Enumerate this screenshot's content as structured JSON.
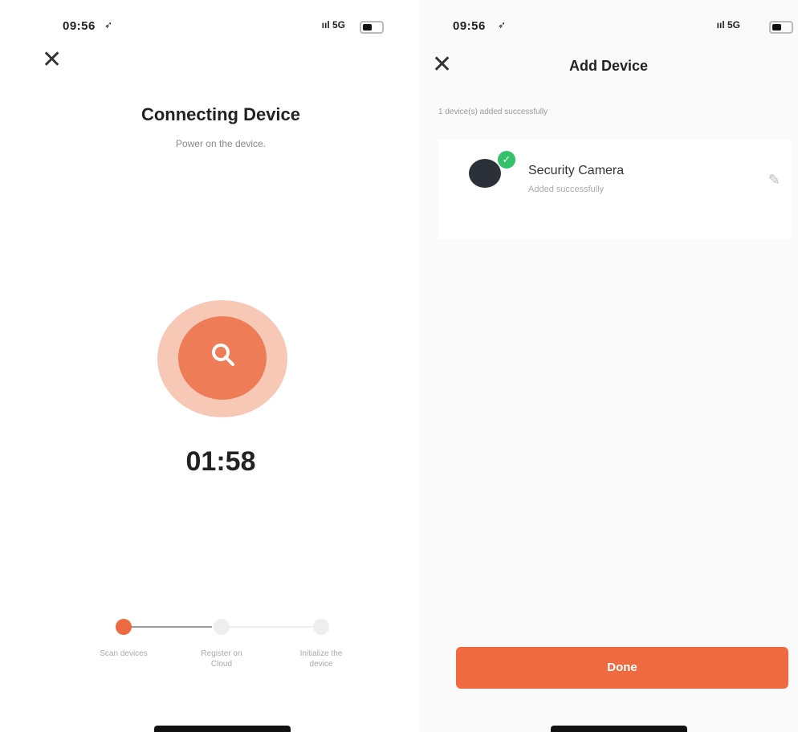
{
  "left_screen": {
    "status": {
      "time": "09:56",
      "location_icon": "location-arrow-icon",
      "signal": "ııl 5G",
      "battery": "battery-icon"
    },
    "close_icon": "close-icon",
    "title": "Connecting Device",
    "subtitle": "Power on the device.",
    "scan_icon": "search-icon",
    "timer": "01:58",
    "steps": [
      {
        "label": "Scan devices",
        "state": "active"
      },
      {
        "label": "Register on Cloud",
        "state": "pending"
      },
      {
        "label": "Initialize the device",
        "state": "pending"
      }
    ],
    "accent": "#ee6a42"
  },
  "right_screen": {
    "status": {
      "time": "09:56",
      "location_icon": "location-arrow-icon",
      "signal": "ııl 5G",
      "battery": "battery-icon"
    },
    "close_icon": "close-icon",
    "title": "Add Device",
    "info": "1 device(s) added successfully",
    "device": {
      "name": "Security Camera",
      "status": "Added successfully",
      "badge_icon": "check-icon",
      "edit_icon": "pencil-icon"
    },
    "done_label": "Done",
    "accent": "#ef6a40"
  }
}
